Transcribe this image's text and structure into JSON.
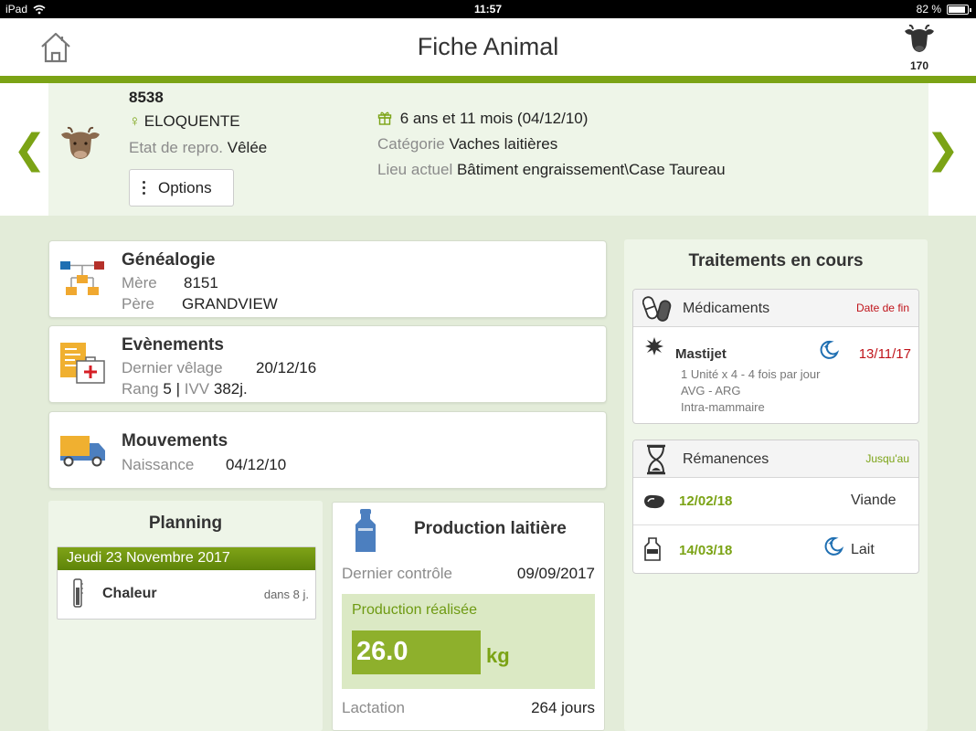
{
  "statusbar": {
    "device": "iPad",
    "time": "11:57",
    "battery": "82 %",
    "battery_level": 0.82
  },
  "header": {
    "title": "Fiche Animal",
    "herd_count": "170"
  },
  "animal": {
    "id": "8538",
    "name": "ELOQUENTE",
    "repro_label": "Etat de repro.",
    "repro_value": "Vêlée",
    "options_label": "Options",
    "age": "6 ans et 11 mois (04/12/10)",
    "categorie_label": "Catégorie",
    "categorie_value": "Vaches laitières",
    "lieu_label": "Lieu actuel",
    "lieu_value": "Bâtiment engraissement\\Case Taureau"
  },
  "genealogie": {
    "title": "Généalogie",
    "mere_label": "Mère",
    "mere_value": "8151",
    "pere_label": "Père",
    "pere_value": "GRANDVIEW"
  },
  "evenements": {
    "title": "Evènements",
    "velage_label": "Dernier vêlage",
    "velage_value": "20/12/16",
    "rang_label": "Rang",
    "rang_value": "5",
    "sep": "|",
    "ivv_label": "IVV",
    "ivv_value": "382j."
  },
  "mouvements": {
    "title": "Mouvements",
    "naissance_label": "Naissance",
    "naissance_value": "04/12/10"
  },
  "planning": {
    "title": "Planning",
    "date": "Jeudi 23 Novembre 2017",
    "event": "Chaleur",
    "delay": "dans 8 j."
  },
  "production": {
    "title": "Production laitière",
    "controle_label": "Dernier contrôle",
    "controle_value": "09/09/2017",
    "realisee_label": "Production réalisée",
    "value": "26.0",
    "unit": "kg",
    "lactation_label": "Lactation",
    "lactation_value": "264 jours"
  },
  "traitements": {
    "title": "Traitements en cours",
    "medicaments": {
      "label": "Médicaments",
      "aside": "Date de fin",
      "item_name": "Mastijet",
      "item_date": "13/11/17",
      "line1": "1 Unité x 4 - 4 fois par jour",
      "line2": "AVG - ARG",
      "line3": "Intra-mammaire"
    },
    "remanences": {
      "label": "Rémanences",
      "aside": "Jusqu'au",
      "rows": [
        {
          "date": "12/02/18",
          "type": "Viande"
        },
        {
          "date": "14/03/18",
          "type": "Lait"
        }
      ]
    }
  },
  "colors": {
    "accent": "#7ba315",
    "danger": "#c0141b",
    "background": "#e3ecd9",
    "panel": "#eef5e8"
  }
}
